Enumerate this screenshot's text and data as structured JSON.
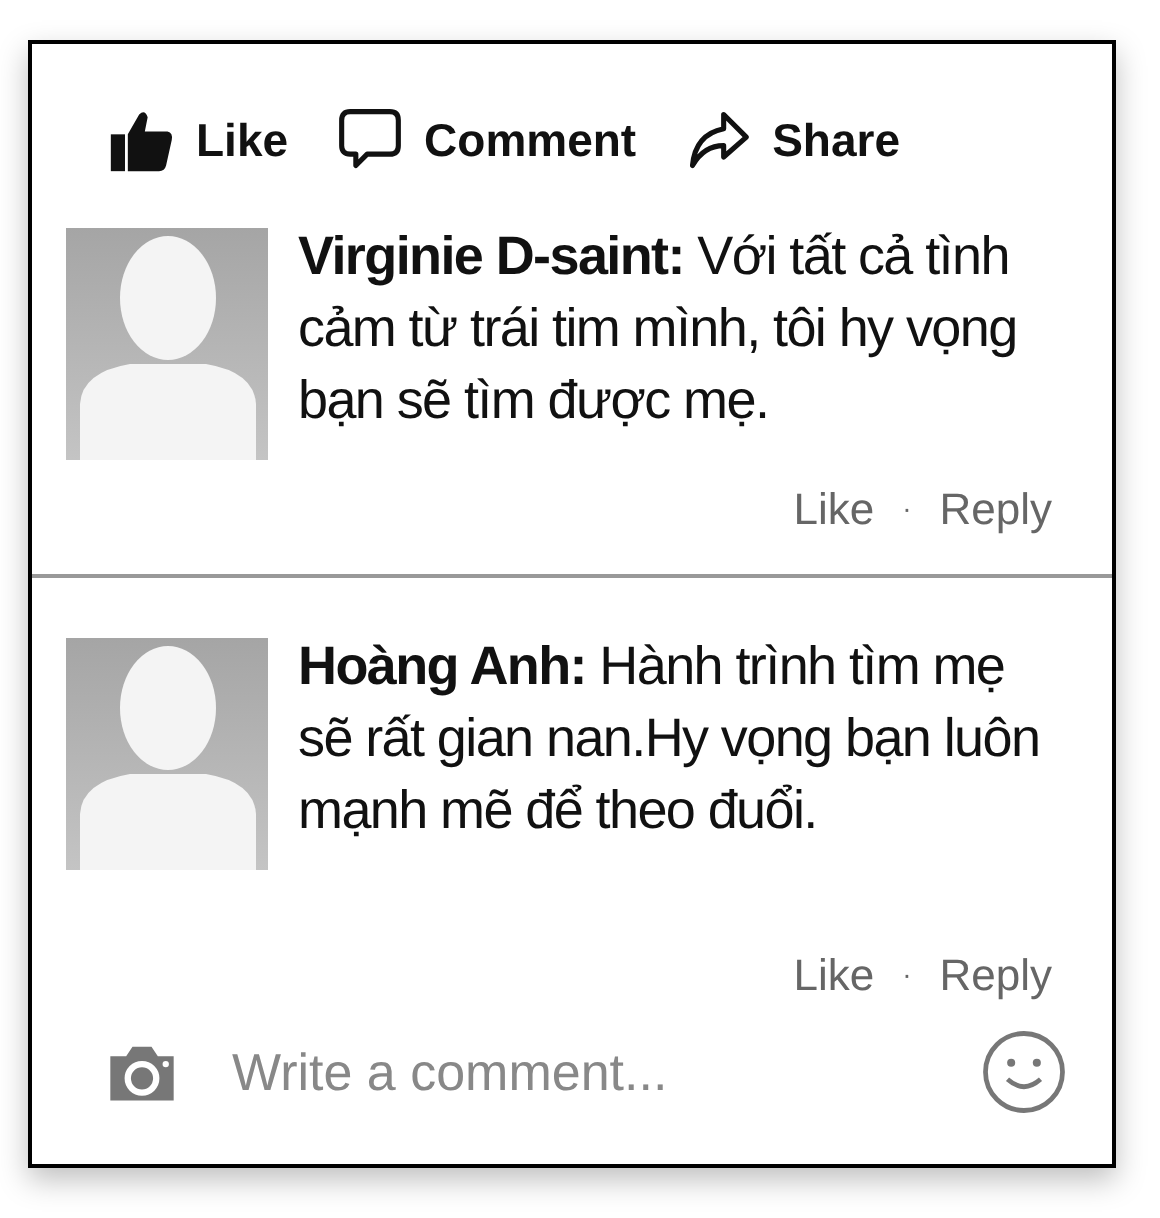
{
  "actions": [
    {
      "kind": "like",
      "label": "Like"
    },
    {
      "kind": "comment",
      "label": "Comment"
    },
    {
      "kind": "share",
      "label": "Share"
    }
  ],
  "comments": [
    {
      "author": "Virginie D-saint:",
      "text": "Với tất cả tình cảm từ trái tim mình, tôi hy vọng bạn sẽ tìm được mẹ.",
      "like": "Like",
      "separator": "·",
      "reply": "Reply"
    },
    {
      "author": "Hoàng Anh:",
      "text": "Hành trình tìm mẹ sẽ rất gian nan.Hy vọng bạn luôn mạnh mẽ để theo đuổi.",
      "like": "Like",
      "separator": "·",
      "reply": "Reply"
    }
  ],
  "composer": {
    "placeholder": "Write a comment..."
  }
}
